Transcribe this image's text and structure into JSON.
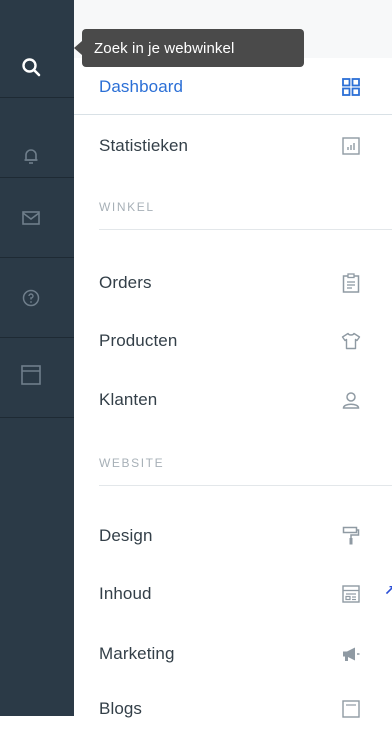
{
  "rail": {
    "items": [
      {
        "name": "search",
        "icon": "search-icon",
        "active": true
      },
      {
        "name": "notifications",
        "icon": "bell-icon",
        "active": false
      },
      {
        "name": "messages",
        "icon": "mail-icon",
        "active": false
      },
      {
        "name": "help",
        "icon": "help-icon",
        "active": false
      },
      {
        "name": "window",
        "icon": "window-icon",
        "active": false
      }
    ]
  },
  "tooltip": {
    "text": "Zoek in je webwinkel"
  },
  "nav": {
    "dashboard": {
      "label": "Dashboard",
      "icon": "grid-icon"
    },
    "statistics": {
      "label": "Statistieken",
      "icon": "chart-icon"
    },
    "section_shop": "WINKEL",
    "orders": {
      "label": "Orders",
      "icon": "clipboard-icon"
    },
    "products": {
      "label": "Producten",
      "icon": "shirt-icon"
    },
    "customers": {
      "label": "Klanten",
      "icon": "user-icon"
    },
    "section_website": "WEBSITE",
    "design": {
      "label": "Design",
      "icon": "paint-roller-icon"
    },
    "content": {
      "label": "Inhoud",
      "icon": "layout-icon"
    },
    "marketing": {
      "label": "Marketing",
      "icon": "megaphone-icon"
    },
    "blogs": {
      "label": "Blogs",
      "icon": "blog-icon"
    }
  },
  "colors": {
    "rail_bg": "#2b3a47",
    "accent": "#2b6fd6",
    "tooltip_bg": "#4a4a4a"
  }
}
